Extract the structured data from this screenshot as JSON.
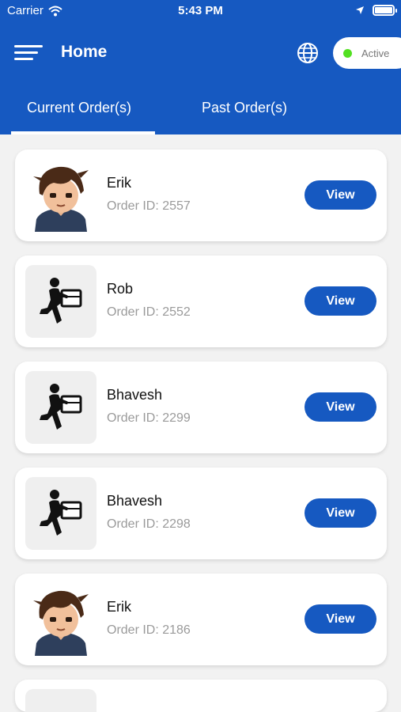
{
  "status_bar": {
    "carrier": "Carrier",
    "time": "5:43 PM"
  },
  "header": {
    "title": "Home",
    "status_label": "Active",
    "status_color": "#52e021"
  },
  "tabs": [
    {
      "label": "Current Order(s)",
      "selected": true
    },
    {
      "label": "Past Order(s)",
      "selected": false
    }
  ],
  "orders": [
    {
      "name": "Erik",
      "order_id": "Order ID: 2557",
      "avatar": "boy-avatar",
      "view_label": "View"
    },
    {
      "name": "Rob",
      "order_id": "Order ID: 2552",
      "avatar": "delivery-person-icon",
      "view_label": "View"
    },
    {
      "name": "Bhavesh",
      "order_id": "Order ID: 2299",
      "avatar": "delivery-person-icon",
      "view_label": "View"
    },
    {
      "name": "Bhavesh",
      "order_id": "Order ID: 2298",
      "avatar": "delivery-person-icon",
      "view_label": "View"
    },
    {
      "name": "Erik",
      "order_id": "Order ID: 2186",
      "avatar": "boy-avatar",
      "view_label": "View"
    }
  ],
  "colors": {
    "primary": "#1659c1",
    "background": "#f2f2f2"
  }
}
